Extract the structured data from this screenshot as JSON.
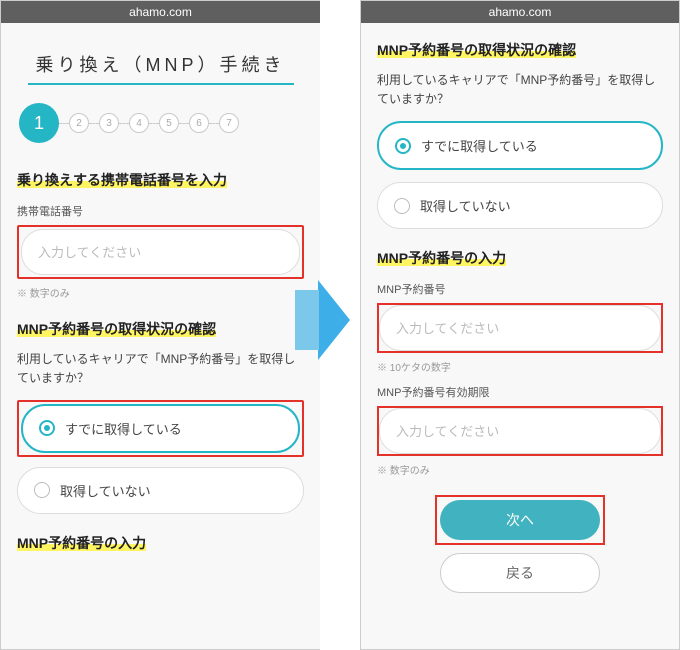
{
  "site": "ahamo.com",
  "left": {
    "title": "乗り換え（MNP）手続き",
    "steps": [
      "1",
      "2",
      "3",
      "4",
      "5",
      "6",
      "7"
    ],
    "sec1_head": "乗り換えする携帯電話番号を入力",
    "phone_label": "携帯電話番号",
    "phone_placeholder": "入力してください",
    "phone_note": "※ 数字のみ",
    "sec2_head": "MNP予約番号の取得状況の確認",
    "sec2_body": "利用しているキャリアで「MNP予約番号」を取得していますか？",
    "opt_yes": "すでに取得している",
    "opt_no": "取得していない",
    "cutoff": "MNP予約番号の入力"
  },
  "right": {
    "sec1_head": "MNP予約番号の取得状況の確認",
    "sec1_body": "利用しているキャリアで「MNP予約番号」を取得していますか？",
    "opt_yes": "すでに取得している",
    "opt_no": "取得していない",
    "sec2_head": "MNP予約番号の入力",
    "resv_label": "MNP予約番号",
    "resv_placeholder": "入力してください",
    "resv_note": "※ 10ケタの数字",
    "exp_label": "MNP予約番号有効期限",
    "exp_placeholder": "入力してください",
    "exp_note": "※ 数字のみ",
    "btn_next": "次へ",
    "btn_back": "戻る"
  }
}
